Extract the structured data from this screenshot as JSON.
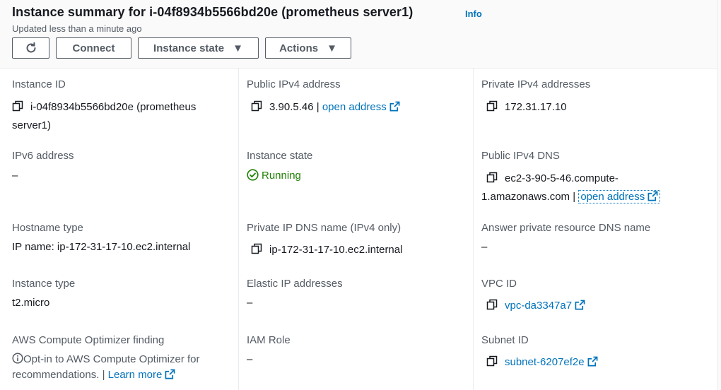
{
  "header": {
    "title": "Instance summary for i-04f8934b5566bd20e (prometheus server1)",
    "info": "Info",
    "updated": "Updated less than a minute ago",
    "buttons": {
      "refresh_icon": "refresh-icon",
      "connect": "Connect",
      "instance_state": "Instance state",
      "actions": "Actions",
      "caret": "▼"
    }
  },
  "fields": {
    "instance_id": {
      "label": "Instance ID",
      "line1": "i-04f8934b5566bd20e (prometheus",
      "line2": "server1)"
    },
    "public_ipv4": {
      "label": "Public IPv4 address",
      "value": "3.90.5.46",
      "sep": "|",
      "link": "open address"
    },
    "private_ipv4": {
      "label": "Private IPv4 addresses",
      "value": "172.31.17.10"
    },
    "ipv6": {
      "label": "IPv6 address",
      "value": "–"
    },
    "instance_state": {
      "label": "Instance state",
      "value": "Running"
    },
    "public_dns": {
      "label": "Public IPv4 DNS",
      "line1": "ec2-3-90-5-46.compute-",
      "line2": "1.amazonaws.com",
      "sep": "|",
      "link": "open address"
    },
    "hostname_type": {
      "label": "Hostname type",
      "value": "IP name: ip-172-31-17-10.ec2.internal"
    },
    "private_dns": {
      "label": "Private IP DNS name (IPv4 only)",
      "value": "ip-172-31-17-10.ec2.internal"
    },
    "answer_dns": {
      "label": "Answer private resource DNS name",
      "value": "–"
    },
    "instance_type": {
      "label": "Instance type",
      "value": "t2.micro"
    },
    "elastic_ip": {
      "label": "Elastic IP addresses",
      "value": "–"
    },
    "vpc_id": {
      "label": "VPC ID",
      "link": "vpc-da3347a7"
    },
    "optimizer": {
      "label": "AWS Compute Optimizer finding",
      "line1": "Opt-in to AWS Compute Optimizer for",
      "line2": "recommendations.",
      "sep": "|",
      "link": "Learn more"
    },
    "iam_role": {
      "label": "IAM Role",
      "value": "–"
    },
    "subnet_id": {
      "label": "Subnet ID",
      "link": "subnet-6207ef2e"
    }
  },
  "colors": {
    "link": "#0073bb",
    "running": "#1d8102",
    "label": "#545b64",
    "text": "#16191f"
  }
}
